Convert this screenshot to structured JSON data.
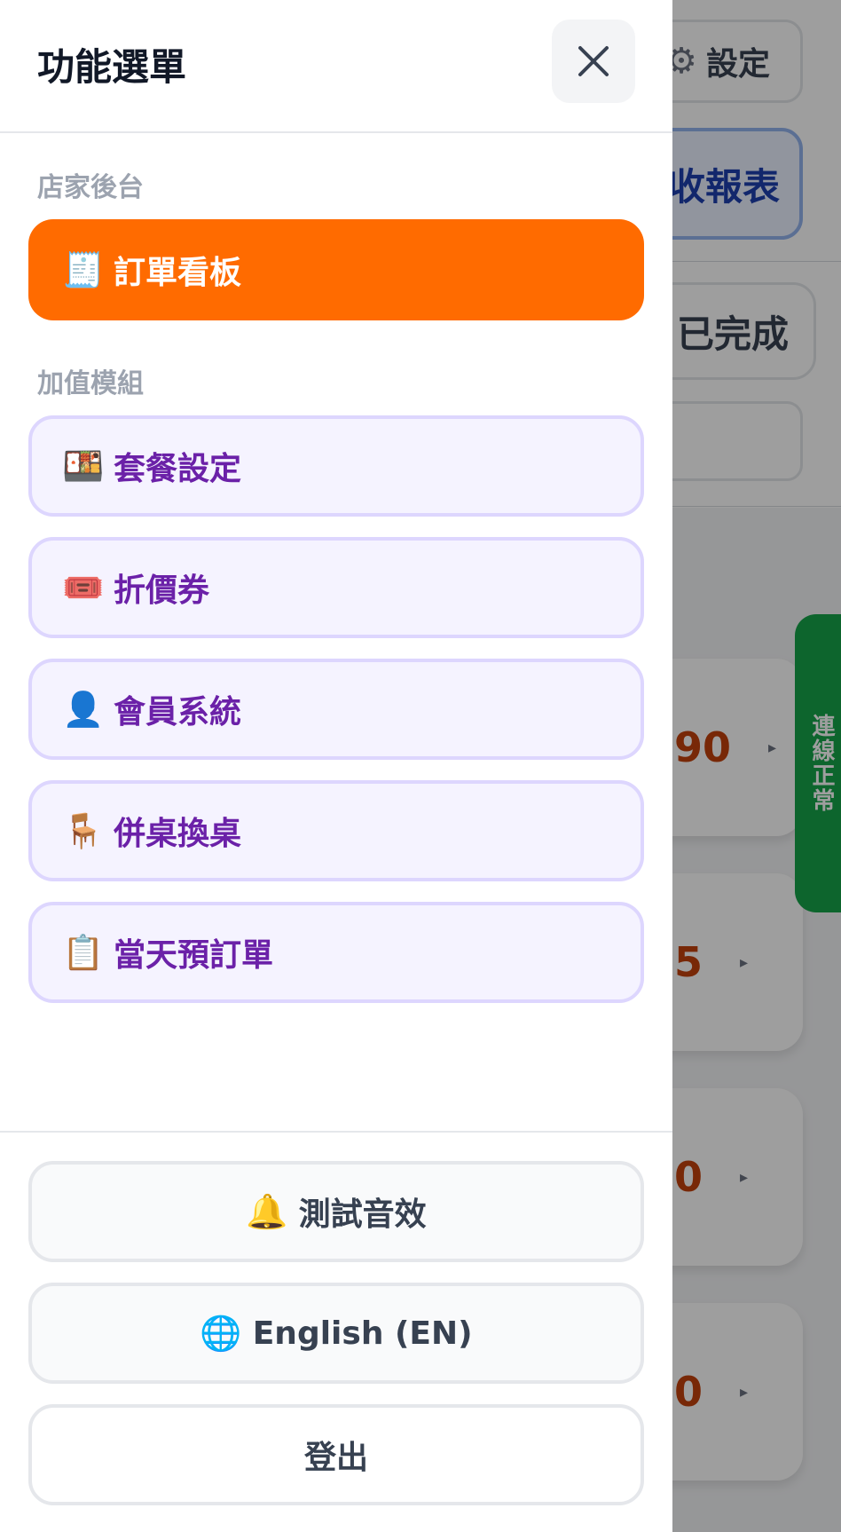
{
  "background": {
    "settings_label": "設定",
    "report_label": "收報表",
    "done_tab_label": "已完成",
    "cards": [
      {
        "value": "90"
      },
      {
        "value": "5"
      },
      {
        "value": "0"
      },
      {
        "value": "0"
      }
    ],
    "connection_status": "連線正常"
  },
  "drawer": {
    "title": "功能選單",
    "section_store": "店家後台",
    "order_board": {
      "icon": "🧾",
      "label": "訂單看板"
    },
    "section_modules": "加值模組",
    "modules": [
      {
        "icon": "🍱",
        "label": "套餐設定"
      },
      {
        "icon": "🎟️",
        "label": "折價券"
      },
      {
        "icon": "👤",
        "label": "會員系統"
      },
      {
        "icon": "🪑",
        "label": "併桌換桌"
      },
      {
        "icon": "📋",
        "label": "當天預訂單"
      }
    ],
    "footer": {
      "test_sound": {
        "icon": "🔔",
        "label": "測試音效"
      },
      "language": {
        "icon": "🌐",
        "label": "English (EN)"
      },
      "logout": {
        "label": "登出"
      }
    }
  },
  "colors": {
    "accent_orange": "#ff6b00",
    "module_bg": "#f5f3ff",
    "module_border": "#ddd6fe",
    "module_text": "#6b21a8",
    "connection_green": "#16a34a"
  }
}
